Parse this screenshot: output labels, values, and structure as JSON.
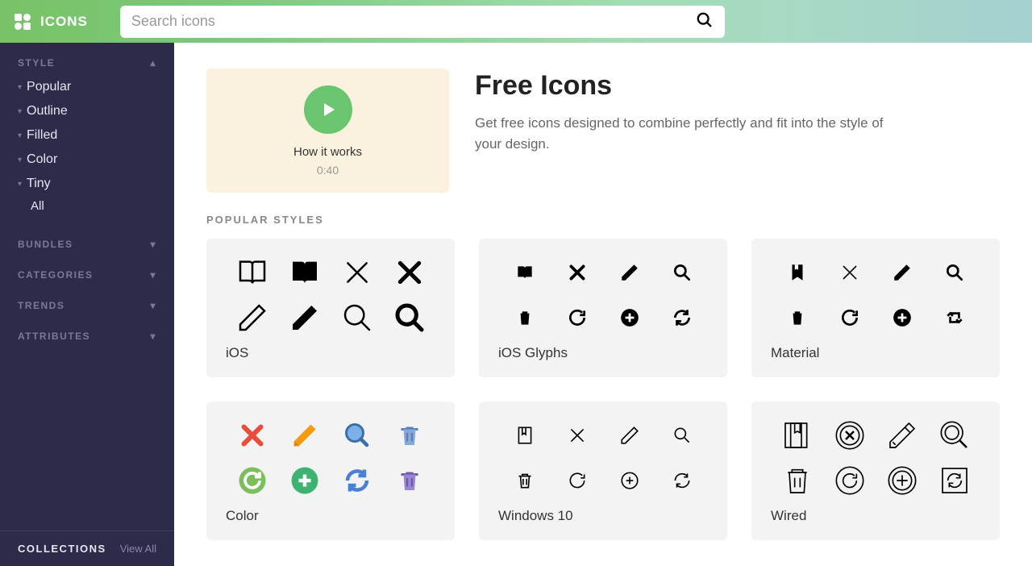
{
  "brand": "ICONS",
  "search": {
    "placeholder": "Search icons"
  },
  "sidebar": {
    "sections": [
      {
        "label": "STYLE",
        "expanded": true
      },
      {
        "label": "BUNDLES",
        "expanded": false
      },
      {
        "label": "CATEGORIES",
        "expanded": false
      },
      {
        "label": "TRENDS",
        "expanded": false
      },
      {
        "label": "ATTRIBUTES",
        "expanded": false
      }
    ],
    "style_items": [
      "Popular",
      "Outline",
      "Filled",
      "Color",
      "Tiny"
    ],
    "style_sub": "All",
    "bottom": {
      "title": "COLLECTIONS",
      "link": "View All"
    }
  },
  "hero": {
    "video": {
      "label": "How it works",
      "duration": "0:40"
    },
    "title": "Free Icons",
    "desc": "Get free icons designed to combine perfectly and fit into the style of your design."
  },
  "popular": {
    "label": "POPULAR STYLES",
    "cards": [
      {
        "name": "iOS",
        "icons": [
          "book-open",
          "book-filled",
          "x-thin",
          "x-bold",
          "pencil-outline",
          "pencil-fill",
          "search-thin",
          "search-bold"
        ]
      },
      {
        "name": "iOS Glyphs",
        "icons": [
          "book",
          "x",
          "pencil",
          "search",
          "trash",
          "reload",
          "plus-circle",
          "sync"
        ]
      },
      {
        "name": "Material",
        "icons": [
          "bookmark",
          "x",
          "pencil",
          "search",
          "trash",
          "reload",
          "plus-circle",
          "retweet"
        ]
      },
      {
        "name": "Color",
        "icons": [
          "x-red",
          "pencil-orange",
          "search-blue",
          "trash-blue",
          "reload-green",
          "plus-green",
          "sync-blue",
          "trash-purple"
        ]
      },
      {
        "name": "Windows 10",
        "icons": [
          "bookmark",
          "x",
          "pencil",
          "search",
          "trash",
          "reload",
          "plus-circle",
          "sync"
        ]
      },
      {
        "name": "Wired",
        "icons": [
          "bookmarks",
          "x-circle",
          "pencil",
          "search",
          "trash",
          "reload-circle",
          "plus-circle",
          "sync-box"
        ]
      }
    ]
  }
}
